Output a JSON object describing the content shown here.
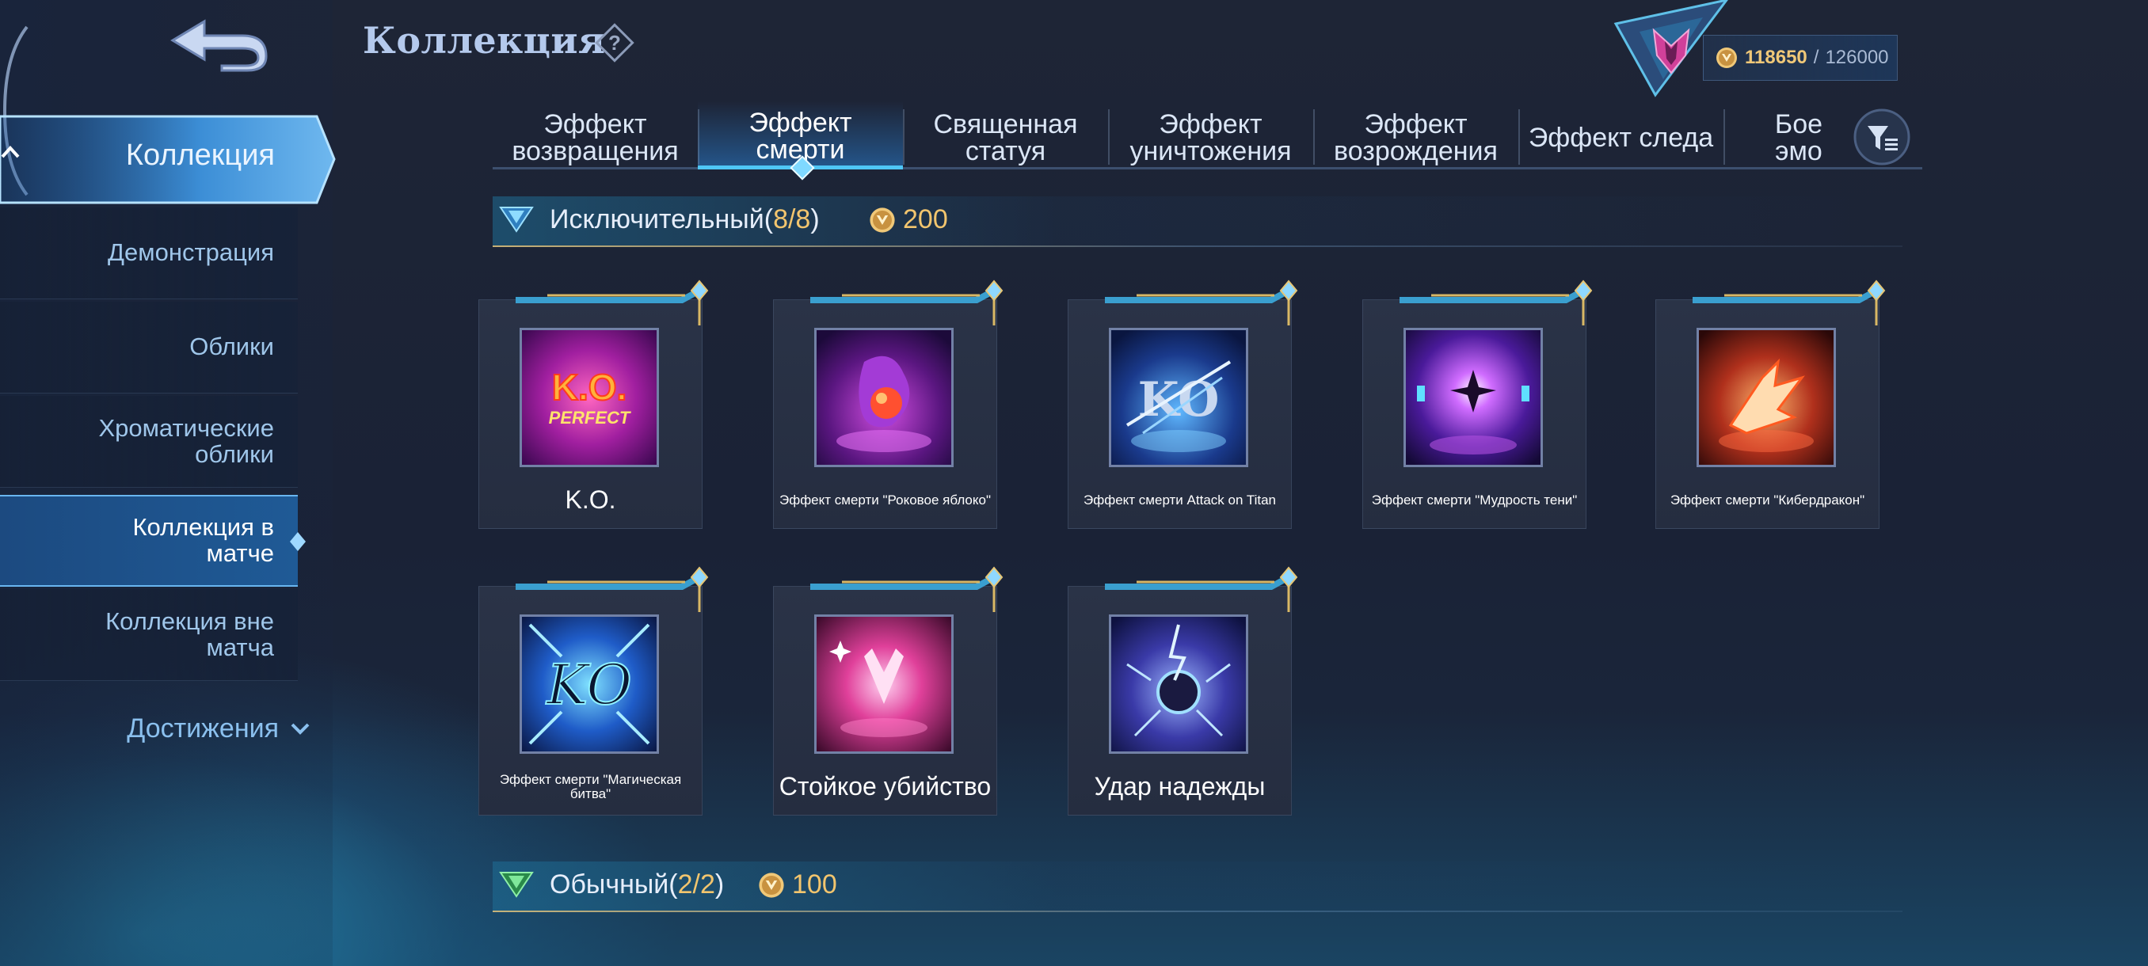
{
  "header": {
    "title": "Коллекция",
    "points": {
      "value": "118650",
      "separator": "/",
      "max": "126000"
    }
  },
  "sidebar": {
    "collection_label": "Коллекция",
    "items": [
      {
        "label": "Демонстрация"
      },
      {
        "label": "Облики"
      },
      {
        "label_line1": "Хроматические",
        "label_line2": "облики"
      },
      {
        "label_line1": "Коллекция в",
        "label_line2": "матче"
      },
      {
        "label_line1": "Коллекция вне",
        "label_line2": "матча"
      }
    ],
    "achievements_label": "Достижения"
  },
  "tabs": [
    {
      "line1": "Эффект",
      "line2": "возвращения"
    },
    {
      "line1": "Эффект",
      "line2": "смерти"
    },
    {
      "line1": "Священная",
      "line2": "статуя"
    },
    {
      "line1": "Эффект",
      "line2": "уничтожения"
    },
    {
      "line1": "Эффект",
      "line2": "возрождения"
    },
    {
      "line1": "Эффект следа",
      "line2": ""
    },
    {
      "line1": "Бое",
      "line2": "эмо"
    }
  ],
  "sections": [
    {
      "title": "Исключительный",
      "count_open": "(",
      "count": "8/8",
      "count_close": ")",
      "cost": "200",
      "gem_color": "#4fb6e8"
    },
    {
      "title": "Обычный",
      "count_open": "(",
      "count": "2/2",
      "count_close": ")",
      "cost": "100",
      "gem_color": "#3fbf6a"
    }
  ],
  "items": [
    {
      "name": "K.O.",
      "size": "big",
      "art": "ko"
    },
    {
      "name": "Эффект смерти \"Роковое яблоко\"",
      "size": "small",
      "art": "apple"
    },
    {
      "name": "Эффект смерти Attack on Titan",
      "size": "small",
      "art": "titan"
    },
    {
      "name": "Эффект смерти \"Мудрость тени\"",
      "size": "small",
      "art": "shadow"
    },
    {
      "name": "Эффект смерти \"Кибердракон\"",
      "size": "small",
      "art": "dragon"
    },
    {
      "name": "Эффект смерти \"Магическая битва\"",
      "size": "small",
      "art": "magic"
    },
    {
      "name": "Стойкое убийство",
      "size": "big",
      "art": "steady"
    },
    {
      "name": "Удар надежды",
      "size": "big",
      "art": "hope"
    }
  ],
  "art_text": {
    "ko_main": "K.O.",
    "ko_sub": "PERFECT",
    "titan": "KO",
    "magic": "KO"
  },
  "colors": {
    "accent": "#4fc6f5",
    "gold": "#f2c56e",
    "title": "#b4c9ec",
    "sidebar_active": "#1f5a96"
  }
}
